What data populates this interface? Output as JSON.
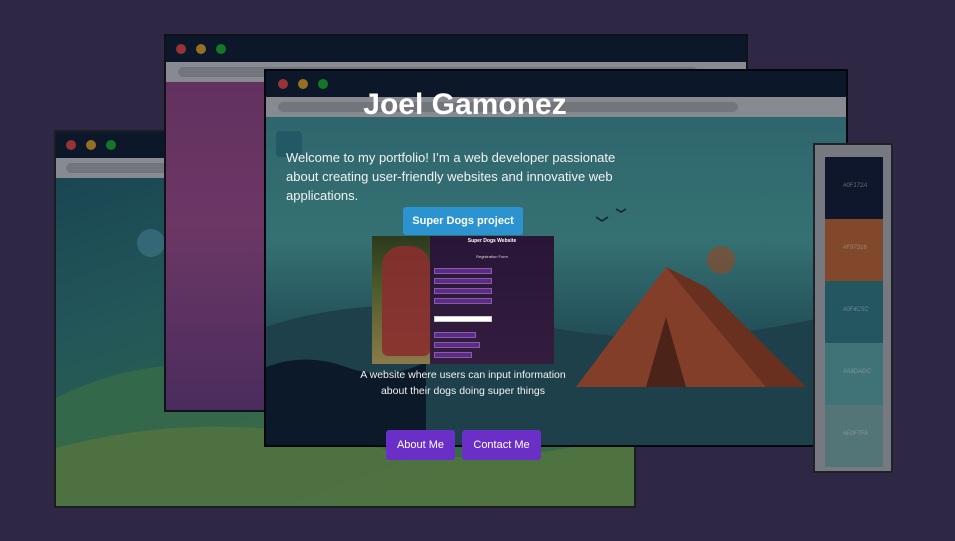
{
  "header": {
    "name": "Joel Gamonez",
    "intro": "Welcome to my portfolio! I’m a web developer passionate about creating user-friendly websites and innovative web applications."
  },
  "project": {
    "button_label": "Super Dogs project",
    "thumbnail_title": "Super Dogs Website",
    "thumbnail_subtitle": "Registration Form",
    "description": "A website where users can input information about their dogs doing super things"
  },
  "nav": {
    "about_label": "About Me",
    "contact_label": "Contact Me"
  },
  "palette": {
    "swatches": [
      {
        "label": "#0F172A",
        "color": "#0f1a2e"
      },
      {
        "label": "#F97316",
        "color": "#c0642f"
      },
      {
        "label": "#0F4C5C",
        "color": "#2f7a80"
      },
      {
        "label": "#A8DADC",
        "color": "#5aa6a3"
      },
      {
        "label": "#E0F7FA",
        "color": "#7aa9a4"
      }
    ]
  },
  "colors": {
    "background": "#3f3354",
    "project_button": "#2a93d0",
    "nav_button": "#6a2fc7"
  }
}
